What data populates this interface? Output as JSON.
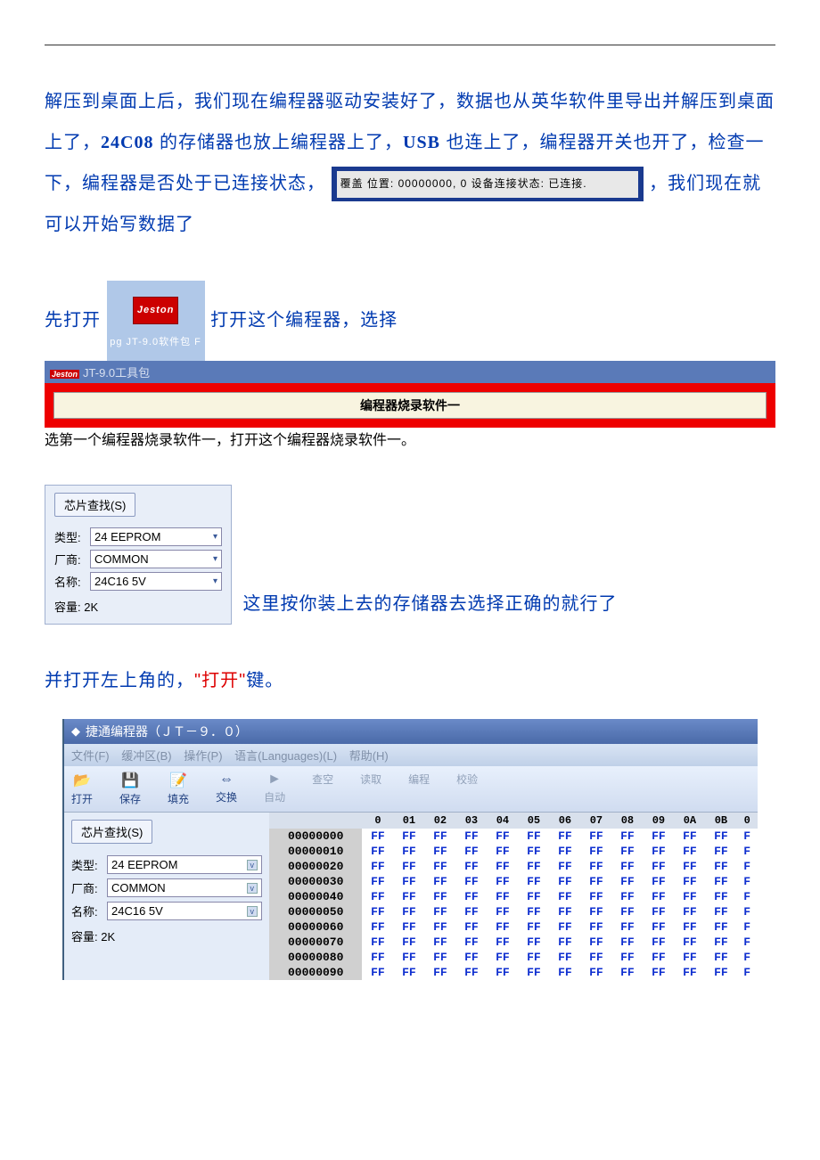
{
  "para1_a": "解压到桌面上后，我们现在编程器驱动安装好了，数据也从英华软件里导出并解压到桌面上了，",
  "para1_b": "24C08",
  "para1_c": " 的存储器也放上编程器上了，",
  "para1_d": "USB",
  "para1_e": " 也连上了，编程器开关也开了，检查一下，编程器是否处于已连接状态，",
  "status_text": "覆盖 位置: 00000000, 0 设备连接状态: 已连接.",
  "para1_f": "，我们现在就可以开始写数据了",
  "para2_a": "先打开",
  "icon_logo": "Jeston",
  "icon_label_pre": "pg",
  "icon_label": "JT-9.0软件包",
  "icon_label_post": "F",
  "para2_b": "打开这个编程器，选择",
  "tool_title": "JT-9.0工具包",
  "tool_btn": "编程器烧录软件一",
  "para2_c": "选第一个编程器烧录软件一，打开这个",
  "para2_red": "编程器烧录软件一。",
  "chip": {
    "search": "芯片查找(S)",
    "type_lbl": "类型:",
    "type_val": "24 EEPROM",
    "vendor_lbl": "厂商:",
    "vendor_val": "COMMON",
    "name_lbl": "名称:",
    "name_val": "24C16 5V",
    "cap": "容量: 2K"
  },
  "para3": "这里按你装上去的存储器去选择正确的就行了",
  "para4_a": "并打开左上角的，",
  "para4_red": "\"打开\"",
  "para4_b": "键。",
  "prog": {
    "title": "捷通编程器（ＪＴ－９．０）",
    "menu": [
      "文件(F)",
      "缓冲区(B)",
      "操作(P)",
      "语言(Languages)(L)",
      "帮助(H)"
    ],
    "toolbar": [
      {
        "icon": "📂",
        "label": "打开"
      },
      {
        "icon": "💾",
        "label": "保存"
      },
      {
        "icon": "📝",
        "label": "填充"
      },
      {
        "icon": "⇔",
        "label": "交换"
      }
    ],
    "toolbar_dim": [
      {
        "icon": "►",
        "label": "自动"
      },
      {
        "icon": "",
        "label": "查空"
      },
      {
        "icon": "",
        "label": "读取"
      },
      {
        "icon": "",
        "label": "编程"
      },
      {
        "icon": "",
        "label": "校验"
      }
    ],
    "hex_cols": [
      "0",
      "01",
      "02",
      "03",
      "04",
      "05",
      "06",
      "07",
      "08",
      "09",
      "0A",
      "0B",
      "0"
    ],
    "hex_rows": [
      "00000000",
      "00000010",
      "00000020",
      "00000030",
      "00000040",
      "00000050",
      "00000060",
      "00000070",
      "00000080",
      "00000090"
    ]
  }
}
